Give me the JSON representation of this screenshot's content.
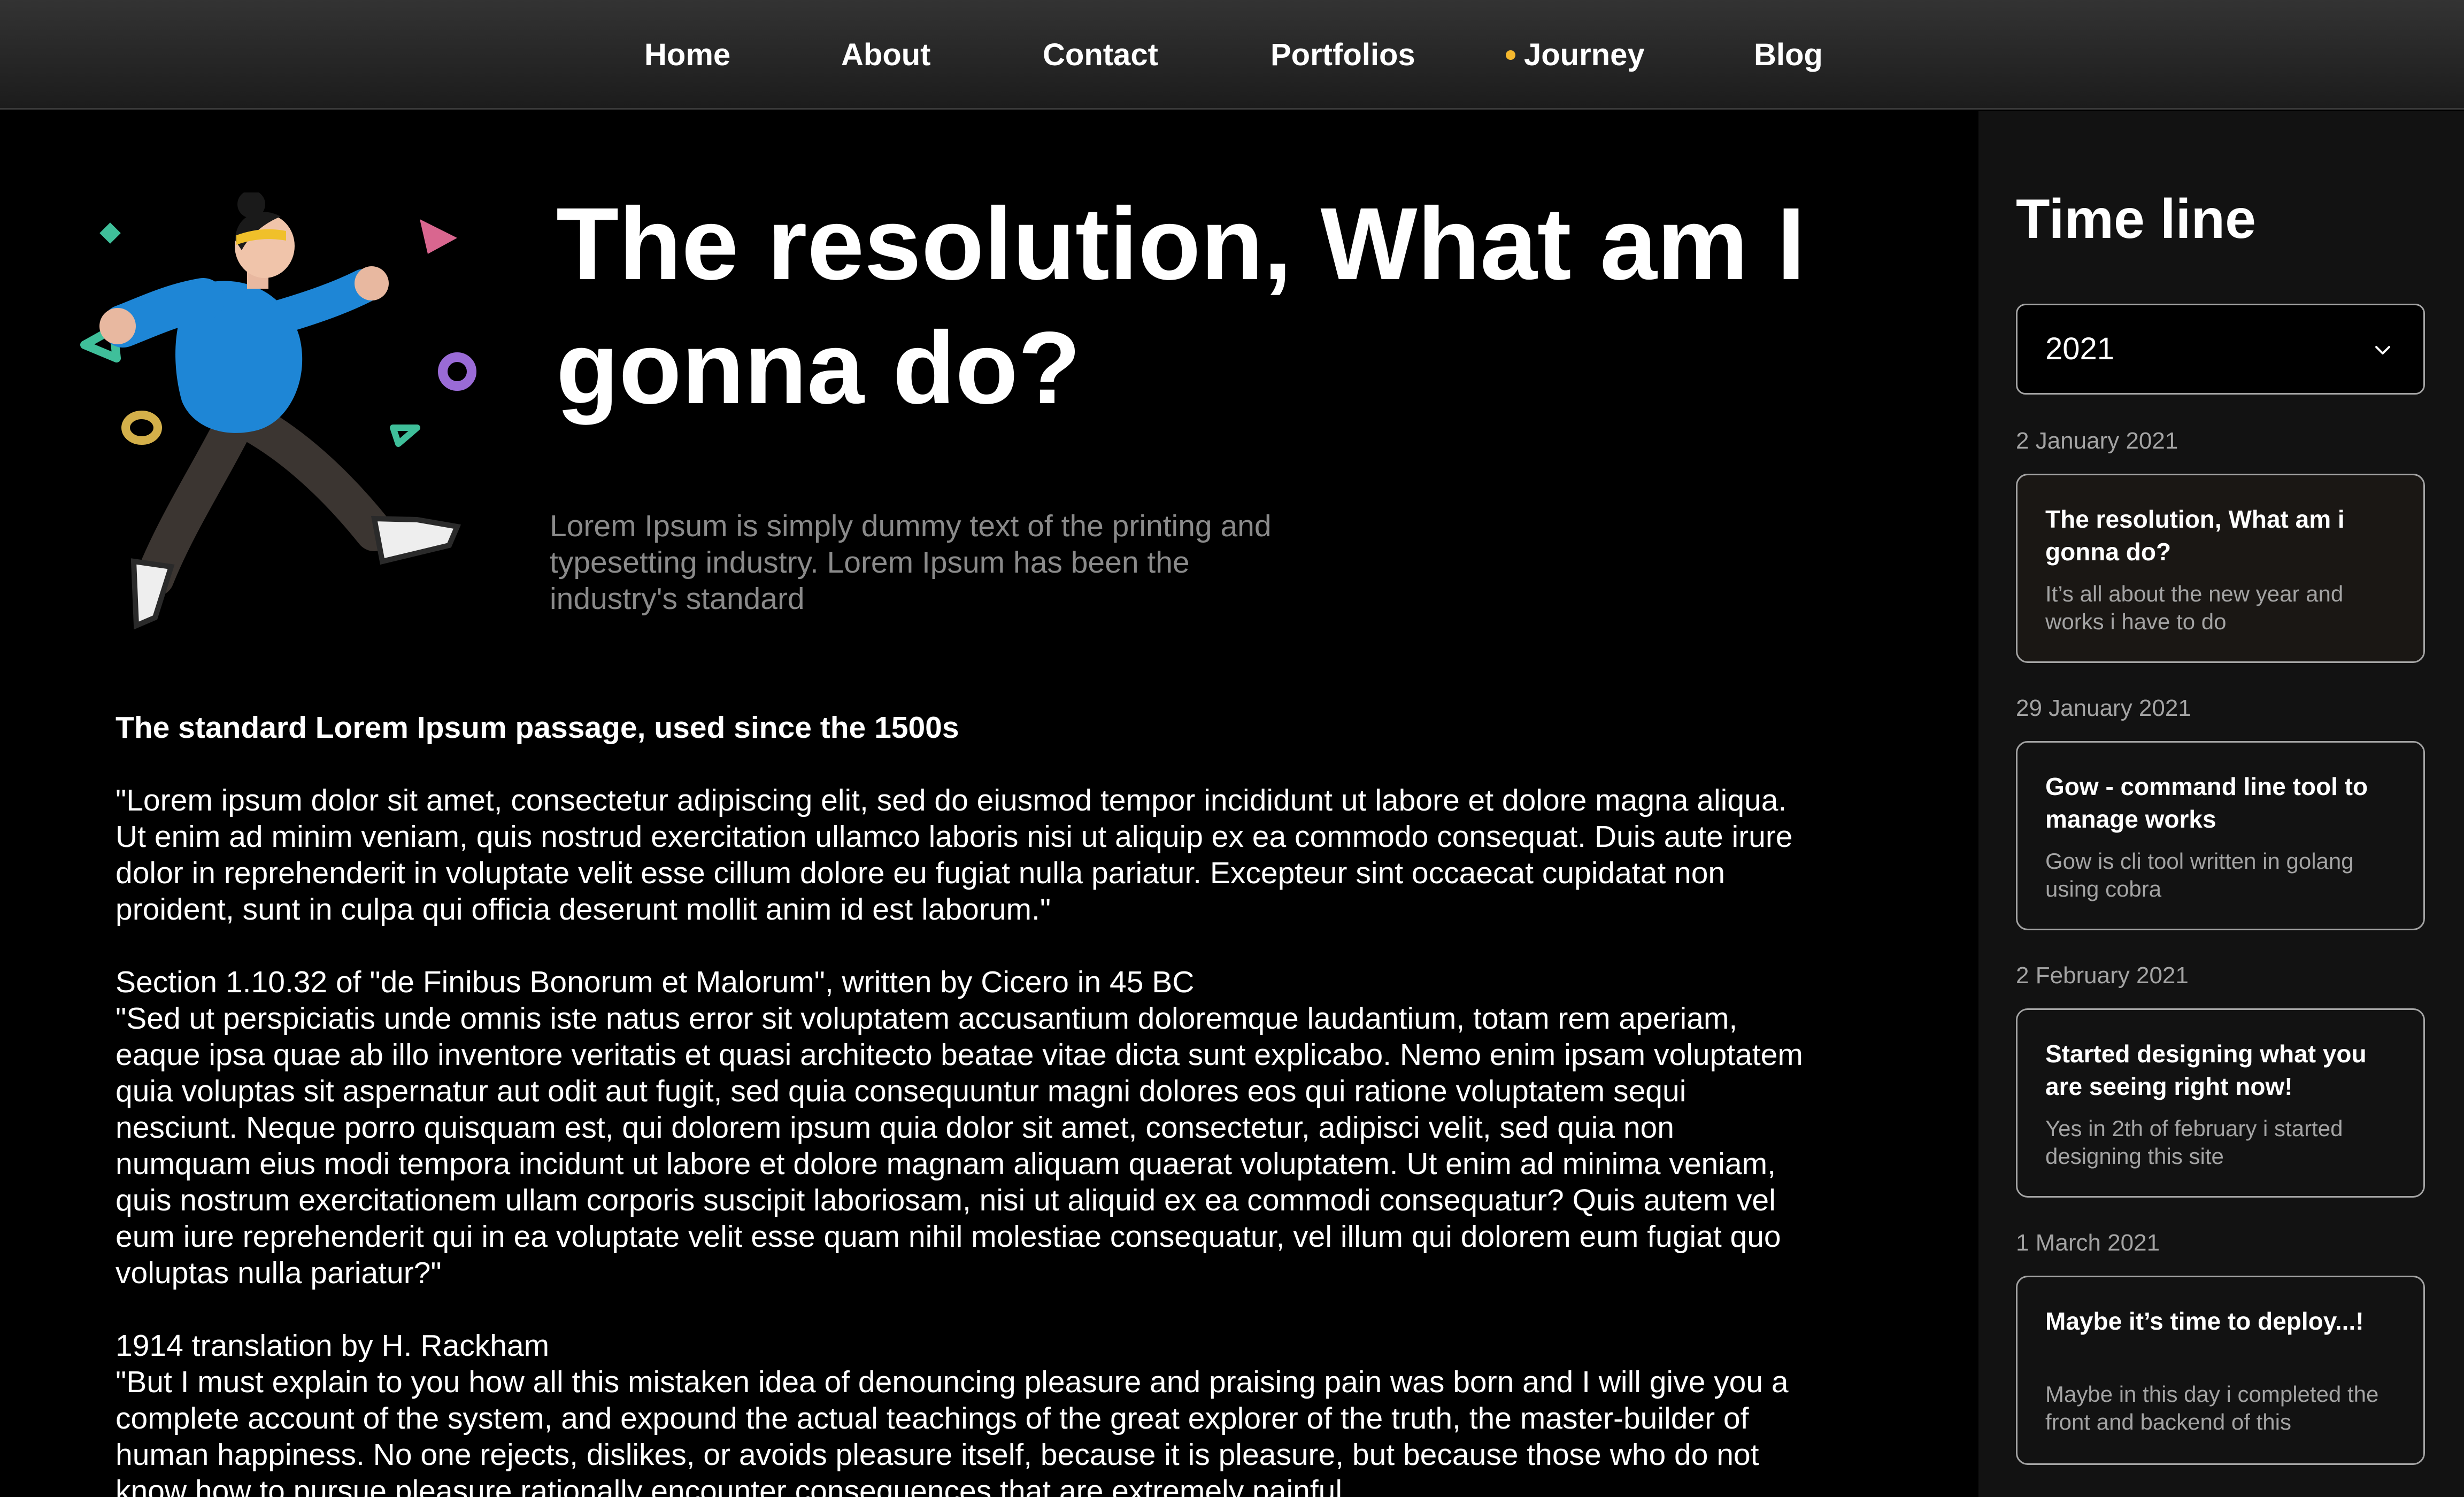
{
  "nav": {
    "items": [
      {
        "label": "Home",
        "active": false
      },
      {
        "label": "About",
        "active": false
      },
      {
        "label": "Contact",
        "active": false
      },
      {
        "label": "Portfolios",
        "active": false
      },
      {
        "label": "Journey",
        "active": true
      },
      {
        "label": "Blog",
        "active": false
      }
    ],
    "active_indicator_color": "#f5b82e"
  },
  "hero": {
    "illustration_icon": "running-person-illustration",
    "title": "The resolution, What am I gonna do?",
    "subtitle": "Lorem Ipsum is simply dummy text of the printing and typesetting industry. Lorem Ipsum has been the industry's standard"
  },
  "article": {
    "heading": "The standard Lorem Ipsum passage, used since the 1500s",
    "paragraph1": "\"Lorem ipsum dolor sit amet, consectetur adipiscing elit, sed do eiusmod tempor incididunt ut labore et dolore magna aliqua. Ut enim ad minim veniam, quis nostrud exercitation ullamco laboris nisi ut aliquip ex ea commodo consequat. Duis aute irure dolor in reprehenderit in voluptate velit esse cillum dolore eu fugiat nulla pariatur. Excepteur sint occaecat cupidatat non proident, sunt in culpa qui officia deserunt mollit anim id est laborum.\"",
    "section2_heading": "Section 1.10.32 of \"de Finibus Bonorum et Malorum\", written by Cicero in 45 BC",
    "section2_body": "\"Sed ut perspiciatis unde omnis iste natus error sit voluptatem accusantium doloremque laudantium, totam rem aperiam, eaque ipsa quae ab illo inventore veritatis et quasi architecto beatae vitae dicta sunt explicabo. Nemo enim ipsam voluptatem quia voluptas sit aspernatur aut odit aut fugit, sed quia consequuntur magni dolores eos qui ratione voluptatem sequi nesciunt. Neque porro quisquam est, qui dolorem ipsum quia dolor sit amet, consectetur, adipisci velit, sed quia non numquam eius modi tempora incidunt ut labore et dolore magnam aliquam quaerat voluptatem. Ut enim ad minima veniam, quis nostrum exercitationem ullam corporis suscipit laboriosam, nisi ut aliquid ex ea commodi consequatur? Quis autem vel eum iure reprehenderit qui in ea voluptate velit esse quam nihil molestiae consequatur, vel illum qui dolorem eum fugiat quo voluptas nulla pariatur?\"",
    "section3_heading": "1914 translation by H. Rackham",
    "section3_body": "\"But I must explain to you how all this mistaken idea of denouncing pleasure and praising pain was born and I will give you a complete account of the system, and expound the actual teachings of the great explorer of the truth, the master-builder of human happiness. No one rejects, dislikes, or avoids pleasure itself, because it is pleasure, but because those who do not know how to pursue pleasure rationally encounter consequences that are extremely painful"
  },
  "sidebar": {
    "title": "Time line",
    "year_select": {
      "value": "2021",
      "icon": "chevron-down-icon"
    },
    "entries": [
      {
        "date": "2 January 2021",
        "title": "The resolution, What am i gonna do?",
        "description": "It’s all about the new year and works i have to do",
        "active": true
      },
      {
        "date": "29 January 2021",
        "title": "Gow - command line tool to manage works",
        "description": "Gow is cli tool written in golang using cobra",
        "active": false
      },
      {
        "date": "2 February 2021",
        "title": "Started designing what you are seeing right now!",
        "description": "Yes in 2th of february i started designing this site",
        "active": false
      },
      {
        "date": "1 March 2021",
        "title": "Maybe it’s time to deploy...!",
        "description": "Maybe in this day i completed the front and backend of this",
        "active": false
      }
    ]
  },
  "colors": {
    "page_background": "#000000",
    "sidebar_background": "#121212",
    "card_border": "#a4a4a4",
    "active_card_background": "#1a1714",
    "muted_text": "#a4a4a4",
    "subtitle_text": "#8a8a8a"
  }
}
